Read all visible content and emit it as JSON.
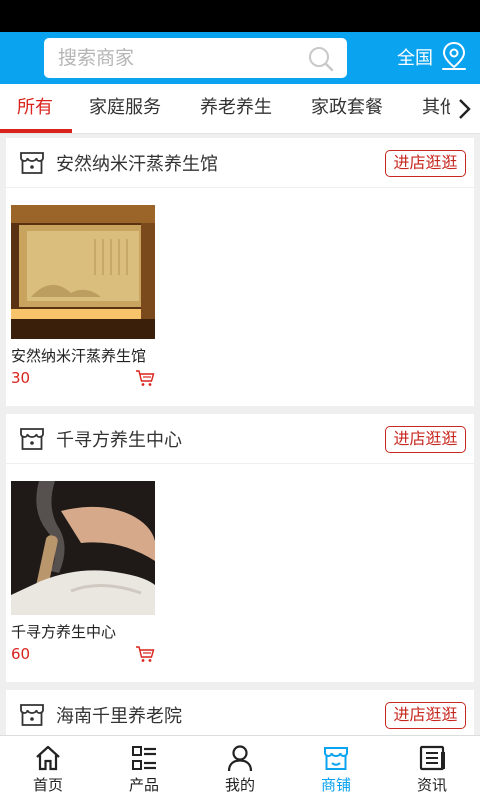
{
  "search": {
    "placeholder": "搜索商家"
  },
  "header": {
    "region_label": "全国"
  },
  "tabs": [
    {
      "label": "所有",
      "active": true
    },
    {
      "label": "家庭服务"
    },
    {
      "label": "养老养生"
    },
    {
      "label": "家政套餐"
    },
    {
      "label": "其他"
    }
  ],
  "shops": [
    {
      "name": "安然纳米汗蒸养生馆",
      "visit_label": "进店逛逛",
      "product": {
        "name": "安然纳米汗蒸养生馆",
        "price": "30"
      }
    },
    {
      "name": "千寻方养生中心",
      "visit_label": "进店逛逛",
      "product": {
        "name": "千寻方养生中心",
        "price": "60"
      }
    },
    {
      "name": "海南千里养老院",
      "visit_label": "进店逛逛"
    }
  ],
  "bottom_nav": [
    {
      "label": "首页",
      "icon": "home-icon"
    },
    {
      "label": "产品",
      "icon": "product-list-icon"
    },
    {
      "label": "我的",
      "icon": "user-icon"
    },
    {
      "label": "商铺",
      "icon": "shop-icon",
      "active": true
    },
    {
      "label": "资讯",
      "icon": "news-icon"
    }
  ],
  "colors": {
    "brand_blue": "#0aa3f0",
    "accent_red": "#d9231c"
  }
}
